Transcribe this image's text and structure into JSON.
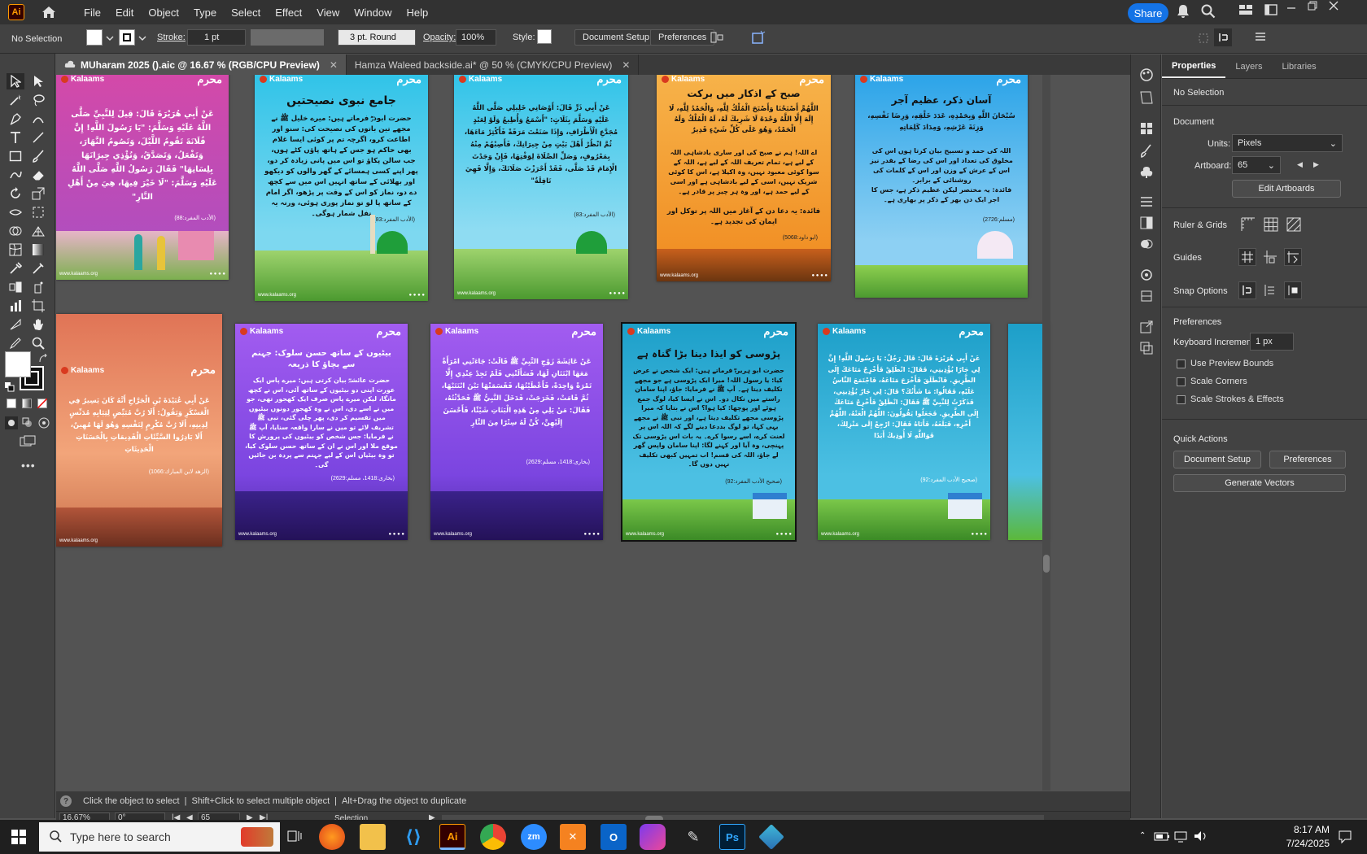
{
  "menubar": {
    "app_logo": "Ai",
    "items": [
      "File",
      "Edit",
      "Object",
      "Type",
      "Select",
      "Effect",
      "View",
      "Window",
      "Help"
    ],
    "share_label": "Share"
  },
  "controlbar": {
    "selection": "No Selection",
    "stroke_label": "Stroke:",
    "stroke_value": "1 pt",
    "brush_value": "3 pt. Round",
    "opacity_label": "Opacity:",
    "opacity_value": "100%",
    "style_label": "Style:",
    "doc_setup_label": "Document Setup",
    "preferences_label": "Preferences"
  },
  "tabs": [
    {
      "label": "MUharam 2025 ().aic @ 16.67 % (RGB/CPU Preview)",
      "active": true
    },
    {
      "label": "Hamza Waleed backside.ai* @ 50 % (CMYK/CPU Preview)",
      "active": false
    }
  ],
  "artboards": {
    "brand": "Kalaams",
    "stamp": "محرم",
    "footer_url": "www.kalaams.org",
    "a1": {
      "body": "عَنْ أَبِي هُرَيْرَةَ قَالَ: قِيلَ لِلنَّبِيِّ صَلَّى اللَّهُ عَلَيْهِ وَسَلَّمَ: \"يَا رَسُولَ اللَّهِ! إِنَّ فُلَانَةَ تَقُومُ اللَّيْلَ، وَتَصُومُ النَّهَارَ، وَتَفْعَلُ، وَتَصَدَّقُ، وَتُؤْذِي جِيرَانَهَا بِلِسَانِهَا\" فَقَالَ رَسُولُ اللَّهِ صَلَّى اللَّهُ عَلَيْهِ وَسَلَّمَ: \"لَا خَيْرَ فِيهَا، هِيَ مِنْ أَهْلِ النَّارِ\"",
      "ref": "(الأدب المفرد:88)"
    },
    "a2": {
      "title": "جامع نبوی نصیحتیں",
      "body": "حضرت ابوذرؓ فرماتے ہیں: میرے خلیل ﷺ نے مجھے تین باتوں کی نصیحت کی: سنو اور اطاعت کرو، اگرچہ تم پر کوئی ایسا غلام بھی حاکم ہو جس کے ہاتھ پاؤں کٹے ہوں، جب سالن پکاؤ تو اس میں پانی زیادہ کر دو، پھر اپنے کسی ہمسائے کے گھر والوں کو دیکھو اور بھلائی کے ساتھ انہیں اس میں سے کچھ دے دو، نماز کو اس کے وقت پر پڑھو، اگر امام کے ساتھ پا لو تو نماز پوری ہوئی، ورنہ یہ نفل شمار ہوگی۔",
      "ref": "(الأدب المفرد:83)"
    },
    "a3": {
      "body": "عَنْ أَبِي ذَرٍّ قَالَ: أَوْصَانِي خَلِيلِي صَلَّى اللَّهُ عَلَيْهِ وَسَلَّمَ بِثَلَاثٍ: \"أَسْمَعُ وَأُطِيعُ وَلَوْ لِعَبْدٍ مُجَدَّعِ الْأَطْرَافِ، وَإِذَا صَنَعْتَ مَرَقَةً فَأَكْثِرْ مَاءَهَا، ثُمَّ انْظُرْ أَهْلَ بَيْتٍ مِنْ جِيرَانِكَ، فَأَصِبْهُمْ مِنْهُ بِمَعْرُوفٍ، وَصَلِّ الصَّلَاةَ لِوَقْتِهَا، فَإِنْ وَجَدْتَ الْإِمَامَ قَدْ صَلَّى، فَقَدْ أَحْرَزْتَ صَلَاتَكَ، وَإِلَّا فَهِيَ نَافِلَةٌ\"",
      "ref": "(الأدب المفرد:83)"
    },
    "a4": {
      "title": "صبح کے اذکار میں برکت",
      "arabic": "اللَّهُمَّ أَصْبَحْنَا وَأَصْبَحَ الْمُلْكُ لِلَّهِ، وَالْحَمْدُ لِلَّهِ، لَا إِلَهَ إِلَّا اللَّهُ وَحْدَهُ لَا شَرِيكَ لَهُ، لَهُ الْمُلْكُ وَلَهُ الْحَمْدُ، وَهُوَ عَلَى كُلِّ شَيْءٍ قَدِيرٌ",
      "body": "اے اللہ! ہم نے صبح کی اور ساری بادشاہی اللہ کے لیے ہے، تمام تعریف اللہ کے لیے ہے، اللہ کے سوا کوئی معبود نہیں، وہ اکیلا ہے، اس کا کوئی شریک نہیں، اسی کے لیے بادشاہی ہے اور اسی کے لیے حمد ہے، اور وہ ہر چیز پر قادر ہے۔",
      "note": "فائدہ: یہ دعا دن کے آغاز میں اللہ پر توکل اور ایمان کی تجدید ہے۔",
      "ref": "(ابو داود:5068)"
    },
    "a5": {
      "title": "آسان ذکر، عظیم آجر",
      "arabic": "سُبْحَانَ اللَّهِ وَبِحَمْدِهِ، عَدَدَ خَلْقِهِ، وَرِضَا نَفْسِهِ، وَزِنَةَ عَرْشِهِ، وَمِدَادَ كَلِمَاتِهِ",
      "body": "اللہ کی حمد و تسبیح بیان کرتا ہوں اس کی مخلوق کی تعداد اور اس کی رضا کے بقدر نیز اس کے عرش کے وزن اور اس کے کلمات کی روشنائی کے برابر۔",
      "note": "فائدہ: یہ مختصر لیکن عظیم ذکر ہے، جس کا اجر ایک دن بھر کے ذکر پر بھاری ہے۔",
      "ref": "(مسلم:2726)"
    },
    "a6": {
      "body": "عَنْ أَبِي عُبَيْدَةَ بْنِ الْجَرَّاحِ أَنَّهُ كَانَ يَسِيرُ فِي الْعَسْكَرِ وَيَقُولُ: أَلَا رُبَّ مُبَيِّضٍ لِثِيَابِهِ مُدَنِّسٍ لِدِينِهِ، أَلَا رُبَّ مُكْرِمٍ لِنَفْسِهِ وَهُوَ لَهَا مُهِينٌ، أَلَا بَادِرُوا السَّيِّئَاتِ الْقَدِيمَاتِ بِالْحَسَنَاتِ الْحَدِيثَاتِ",
      "ref": "(الزهد لابن المبارك:1066)"
    },
    "a7": {
      "title": "بیٹیوں کے ساتھ حسن سلوک: جہنم سے بچاؤ کا ذریعہ",
      "body": "حضرت عائشہؓ بیان کرتی ہیں: میرے پاس ایک عورت اپنی دو بیٹیوں کے ساتھ آئی، اس نے کچھ مانگا، لیکن میرے پاس صرف ایک کھجور تھی، جو میں نے اسے دی، اس نے وہ کھجور دونوں بیٹیوں میں تقسیم کر دی، پھر چلی گئی، نبی ﷺ تشریف لائے تو میں نے سارا واقعہ سنایا، آپ ﷺ نے فرمایا: جس شخص کو بیٹیوں کی پرورش کا موقع ملا اور اس نے ان کے ساتھ حسن سلوک کیا، تو وہ بیٹیاں اس کے لیے جہنم سے پردہ بن جائیں گی۔",
      "ref": "(بخاری:1418، مسلم:2629)"
    },
    "a8": {
      "body": "عَنْ عَائِشَةَ زَوْجِ النَّبِيِّ ﷺ قَالَتْ: جَاءَتْنِي امْرَأَةٌ مَعَهَا ابْنَتَانِ لَهَا، فَسَأَلَتْنِي فَلَمْ تَجِدْ عِنْدِي إِلَّا تَمْرَةً وَاحِدَةً، فَأَعْطَيْتُهَا، فَقَسَمَتْهَا بَيْنَ ابْنَتَيْهَا، ثُمَّ قَامَتْ، فَخَرَجَتْ، فَدَخَلَ النَّبِيُّ ﷺ فَحَدَّثْتُهُ، فَقَالَ: مَنْ يَلِي مِنْ هَذِهِ الْبَنَاتِ شَيْئًا، فَأَحْسَنَ إِلَيْهِنَّ، كُنَّ لَهُ سِتْرًا مِنَ النَّارِ",
      "ref": "(بخاری:1418، مسلم:2629)"
    },
    "a9": {
      "title": "پڑوسی کو ایذا دینا بڑا گناہ ہے",
      "body": "حضرت ابو ہریرہؓ فرماتے ہیں: ایک شخص نے عرض کیا: یا رسول اللہ! میرا ایک پڑوسی ہے جو مجھے تکلیف دیتا ہے۔ آپ ﷺ نے فرمایا: جاؤ، اپنا سامان راستے میں نکال دو۔ اس نے ایسا کیا، لوگ جمع ہوئے اور پوچھا: کیا ہوا؟ اس نے بتایا کہ میرا پڑوسی مجھے تکلیف دیتا ہے، اور نبی ﷺ نے مجھے یہی کہا، تو لوگ بددعا دینے لگے کہ اللہ اس پر لعنت کرے، اسے رسوا کرے۔ یہ بات اس پڑوسی تک پہنچی، وہ آیا اور کہنے لگا: اپنا سامان واپس گھر لے جاؤ، اللہ کی قسم! اب تمہیں کبھی تکلیف نہیں دوں گا۔",
      "ref": "(صحیح الأدب المفرد:92)"
    },
    "a10": {
      "body": "عَنْ أَبِي هُرَيْرَةَ قَالَ: قَالَ رَجُلٌ: يَا رَسُولَ اللَّهِ! إِنَّ لِي جَارًا يُؤْذِينِي، فَقَالَ: انْطَلِقْ فَأَخْرِجْ مَتَاعَكَ إِلَى الطَّرِيقِ. فَانْطَلَقَ فَأَخْرَجَ مَتَاعَهُ، فَاجْتَمَعَ النَّاسُ عَلَيْهِ، فَقَالُوا: مَا شَأْنُكَ؟ قَالَ: لِي جَارٌ يُؤْذِينِي، فَذَكَرْتُ لِلنَّبِيِّ ﷺ فَقَالَ: انْطَلِقْ فَأَخْرِجْ مَتَاعَكَ إِلَى الطَّرِيقِ. فَجَعَلُوا يَقُولُونَ: اللَّهُمَّ الْعَنْهُ، اللَّهُمَّ أَخْزِهِ، فَبَلَغَهُ، فَأَتَاهُ فَقَالَ: ارْجِعْ إِلَى مَنْزِلِكَ، فَوَاللَّهِ لَا أُوذِيكَ أَبَدًا",
      "ref": "(صحیح الأدب المفرد:92)"
    }
  },
  "properties": {
    "tabs": [
      "Properties",
      "Layers",
      "Libraries"
    ],
    "selection": "No Selection",
    "document_heading": "Document",
    "units_label": "Units:",
    "units_value": "Pixels",
    "artboard_label": "Artboard:",
    "artboard_value": "65",
    "edit_artboards": "Edit Artboards",
    "rulers_grids": "Ruler & Grids",
    "guides": "Guides",
    "snap_options": "Snap Options",
    "preferences_heading": "Preferences",
    "keyboard_increment_label": "Keyboard Increment:",
    "keyboard_increment_value": "1 px",
    "use_preview_bounds": "Use Preview Bounds",
    "scale_corners": "Scale Corners",
    "scale_strokes": "Scale Strokes & Effects",
    "quick_actions": "Quick Actions",
    "document_setup": "Document Setup",
    "preferences": "Preferences",
    "generate_vectors": "Generate Vectors"
  },
  "hint": {
    "text1": "Click the object to select",
    "text2": "Shift+Click to select multiple object",
    "text3": "Alt+Drag the object to duplicate"
  },
  "status": {
    "zoom": "16.67%",
    "rotation": "0°",
    "artboard": "65",
    "mode": "Selection"
  },
  "taskbar": {
    "search_placeholder": "Type here to search",
    "time": "8:17 AM",
    "date": "7/24/2025"
  },
  "colors": {
    "accent": "#1473e6",
    "panel": "#424242",
    "canvas": "#535353",
    "illustrator_orange": "#ff9a00"
  }
}
